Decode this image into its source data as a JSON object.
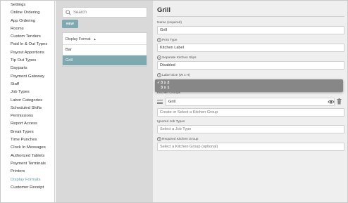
{
  "sidebar": {
    "items": [
      {
        "label": "Settings"
      },
      {
        "label": "Online Ordering"
      },
      {
        "label": "App Ordering"
      },
      {
        "label": "Rooms"
      },
      {
        "label": "Custom Tenders"
      },
      {
        "label": "Paid In & Out Types"
      },
      {
        "label": "Payout Apportions"
      },
      {
        "label": "Tip Out Types"
      },
      {
        "label": "Dayparts"
      },
      {
        "label": "Payment Gateway"
      },
      {
        "label": "Staff"
      },
      {
        "label": "Job Types"
      },
      {
        "label": "Labor Categories"
      },
      {
        "label": "Scheduled Shifts"
      },
      {
        "label": "Permissions"
      },
      {
        "label": "Report Access"
      },
      {
        "label": "Break Types"
      },
      {
        "label": "Time Punches"
      },
      {
        "label": "Clock In Messages"
      },
      {
        "label": "Authorized Tablets"
      },
      {
        "label": "Payment Terminals"
      },
      {
        "label": "Printers"
      },
      {
        "label": "Display Formats"
      },
      {
        "label": "Customer Receipt"
      }
    ],
    "active_index": 22
  },
  "list_panel": {
    "search_placeholder": "Search",
    "new_button": "NEW",
    "column_header": "Display Format",
    "rows": [
      "Bar",
      "Grill"
    ],
    "selected_index": 1
  },
  "form": {
    "title": "Grill",
    "name_label": "Name (required)",
    "name_value": "Grill",
    "print_type_label": "Print Type",
    "print_type_value": "Kitchen Label",
    "separate_slips_label": "Separate Kitchen Slips",
    "separate_slips_value": "Disabled",
    "label_size_label": "Label Size (W x H)",
    "label_size_options": [
      "3 x 2",
      "3 x 1"
    ],
    "label_size_selected": 0,
    "kitchen_groups_label": "Kitchen Groups",
    "kitchen_group_item": "Grill",
    "kitchen_group_placeholder": "Create or Select a Kitchen Group",
    "ignored_job_types_label": "Ignored Job Types",
    "ignored_job_types_placeholder": "Select a Job Type",
    "required_kitchen_group_label": "Required Kitchen Group",
    "required_kitchen_group_placeholder": "Select a Kitchen Group (optional)"
  },
  "colors": {
    "accent": "#7fa9b0",
    "active_link": "#5f9ea5",
    "form_background": "#efefef",
    "list_background": "#d9d9d9",
    "dropdown_background": "#878787"
  },
  "icons": [
    "search-icon",
    "help-icon",
    "checkmark-icon",
    "drag-handle-icon",
    "eye-icon",
    "trash-icon",
    "sort-caret-icon"
  ]
}
